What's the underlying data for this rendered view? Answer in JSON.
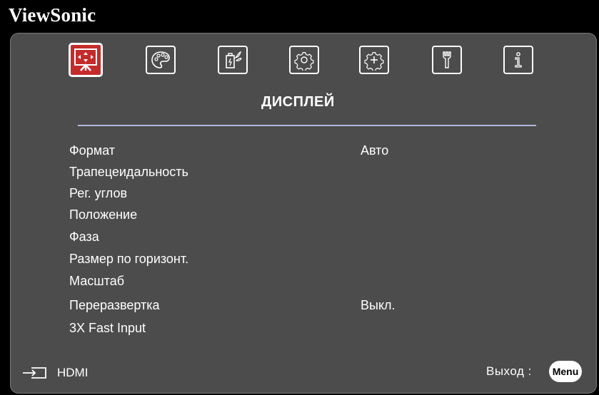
{
  "brand": "ViewSonic",
  "colors": {
    "panel": "#4c4c4c",
    "accent_active": "#c42b2b",
    "divider": "#b3b8de",
    "text": "#ffffff"
  },
  "tabs": [
    {
      "name": "display",
      "icon": "display-screen-icon",
      "active": true
    },
    {
      "name": "image",
      "icon": "palette-icon",
      "active": false
    },
    {
      "name": "power",
      "icon": "power-management-icon",
      "active": false
    },
    {
      "name": "basic",
      "icon": "gear-icon",
      "active": false
    },
    {
      "name": "advanced",
      "icon": "advanced-gear-icon",
      "active": false
    },
    {
      "name": "settings",
      "icon": "wrench-icon",
      "active": false
    },
    {
      "name": "info",
      "icon": "info-icon",
      "active": false
    }
  ],
  "section_title": "ДИСПЛЕЙ",
  "menu": [
    {
      "label": "Формат",
      "value": "Авто"
    },
    {
      "label": "Трапецеидальность",
      "value": ""
    },
    {
      "label": "Рег. углов",
      "value": ""
    },
    {
      "label": "Положение",
      "value": ""
    },
    {
      "label": "Фаза",
      "value": ""
    },
    {
      "label": "Размер по горизонт.",
      "value": ""
    },
    {
      "label": "Масштаб",
      "value": ""
    },
    {
      "label": "Переразвертка",
      "value": "Выкл."
    },
    {
      "label": "3X Fast Input",
      "value": ""
    }
  ],
  "footer": {
    "source_icon": "input-source-icon",
    "source_label": "HDMI",
    "exit_label": "Выход :",
    "menu_button": "Menu"
  }
}
